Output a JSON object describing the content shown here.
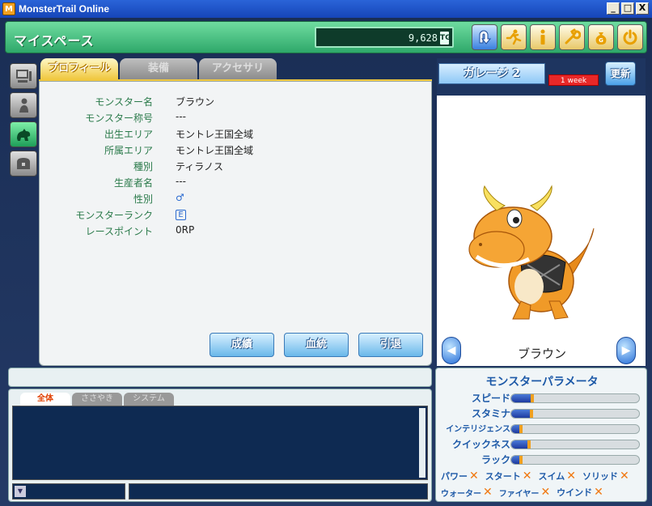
{
  "window": {
    "title": "MonsterTrail Online",
    "app_icon_letter": "M",
    "minimize": "_",
    "maximize": "□",
    "close": "X"
  },
  "header": {
    "title": "マイスペース",
    "money": "9,628",
    "money_unit": "TG"
  },
  "header_icons": [
    "back-arrow-icon",
    "running-man-icon",
    "info-icon",
    "wrench-icon",
    "money-bag-icon",
    "power-icon"
  ],
  "profile": {
    "tabs": [
      {
        "label": "プロフィール",
        "active": true
      },
      {
        "label": "装備",
        "active": false
      },
      {
        "label": "アクセサリ",
        "active": false
      }
    ],
    "fields": [
      {
        "label": "モンスター名",
        "value": "ブラウン"
      },
      {
        "label": "モンスター称号",
        "value": "---"
      },
      {
        "label": "出生エリア",
        "value": "モントレ王国全域"
      },
      {
        "label": "所属エリア",
        "value": "モントレ王国全域"
      },
      {
        "label": "種別",
        "value": "ティラノス"
      },
      {
        "label": "生産者名",
        "value": "---"
      },
      {
        "label": "性別",
        "value": "♂"
      },
      {
        "label": "モンスターランク",
        "value": "E"
      },
      {
        "label": "レースポイント",
        "value": "0RP"
      }
    ],
    "buttons": {
      "record": "成績",
      "lineage": "血統",
      "retire": "引退"
    }
  },
  "garage": {
    "label": "ガレージ 2",
    "badge": "1 week",
    "refresh": "更新",
    "monster_name": "ブラウン"
  },
  "chat": {
    "tabs": [
      {
        "label": "全体",
        "active": true
      },
      {
        "label": "ささやき",
        "active": false
      },
      {
        "label": "システム",
        "active": false
      }
    ]
  },
  "parameters": {
    "title": "モンスターパラメータ",
    "stats": [
      {
        "label": "スピード",
        "value": 0.18
      },
      {
        "label": "スタミナ",
        "value": 0.17
      },
      {
        "label": "インテリジェンス",
        "value": 0.09
      },
      {
        "label": "クイックネス",
        "value": 0.15
      },
      {
        "label": "ラック",
        "value": 0.09
      }
    ],
    "attributes_row1": [
      "パワー",
      "スタート",
      "スイム",
      "ソリッド"
    ],
    "attributes_row2": [
      "ウォーター",
      "ファイヤー",
      "ウインド"
    ],
    "attr_mark": "✕"
  }
}
